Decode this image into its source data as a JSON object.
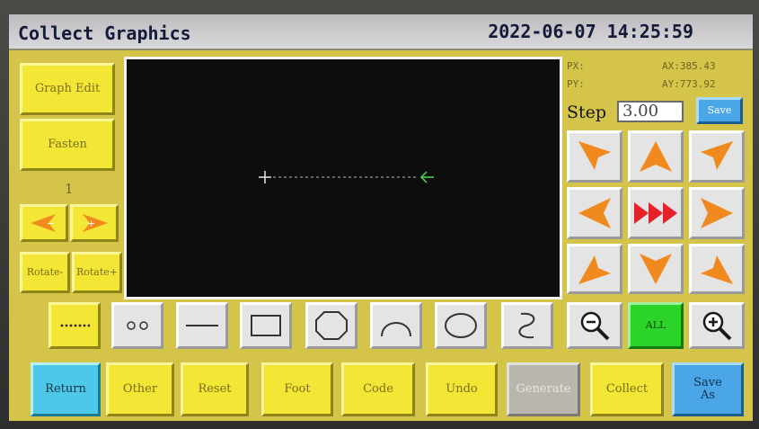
{
  "title": "Collect Graphics",
  "datetime": "2022-06-07 14:25:59",
  "left_panel": {
    "graph_edit": "Graph Edit",
    "fasten": "Fasten",
    "page_number": "1",
    "rotate_left": "Rotate-",
    "rotate_right": "Rotate+"
  },
  "readouts": {
    "px_label": "PX:",
    "py_label": "PY:",
    "ax": "AX:385.43",
    "ay": "AY:773.92"
  },
  "step": {
    "label": "Step",
    "value": "3.00",
    "save": "Save"
  },
  "zoom": {
    "all": "ALL"
  },
  "drawing_tools": [
    {
      "name": "dotted-line-tool",
      "selected": true
    },
    {
      "name": "two-point-tool"
    },
    {
      "name": "straight-line-tool"
    },
    {
      "name": "rectangle-tool"
    },
    {
      "name": "octagon-tool"
    },
    {
      "name": "arc-tool"
    },
    {
      "name": "ellipse-tool"
    },
    {
      "name": "curve-tool"
    }
  ],
  "bottom_bar": {
    "return": "Return",
    "other": "Other",
    "reset": "Reset",
    "foot": "Foot",
    "code": "Code",
    "undo": "Undo",
    "generate": "Generate",
    "collect": "Collect",
    "save_as_line1": "Save",
    "save_as_line2": "As"
  },
  "colors": {
    "panel": "#d4c54a",
    "button": "#f3e634",
    "arrow": "#f08a1e",
    "fast_arrow": "#e8202a",
    "canvas": "#0d0d0d"
  }
}
